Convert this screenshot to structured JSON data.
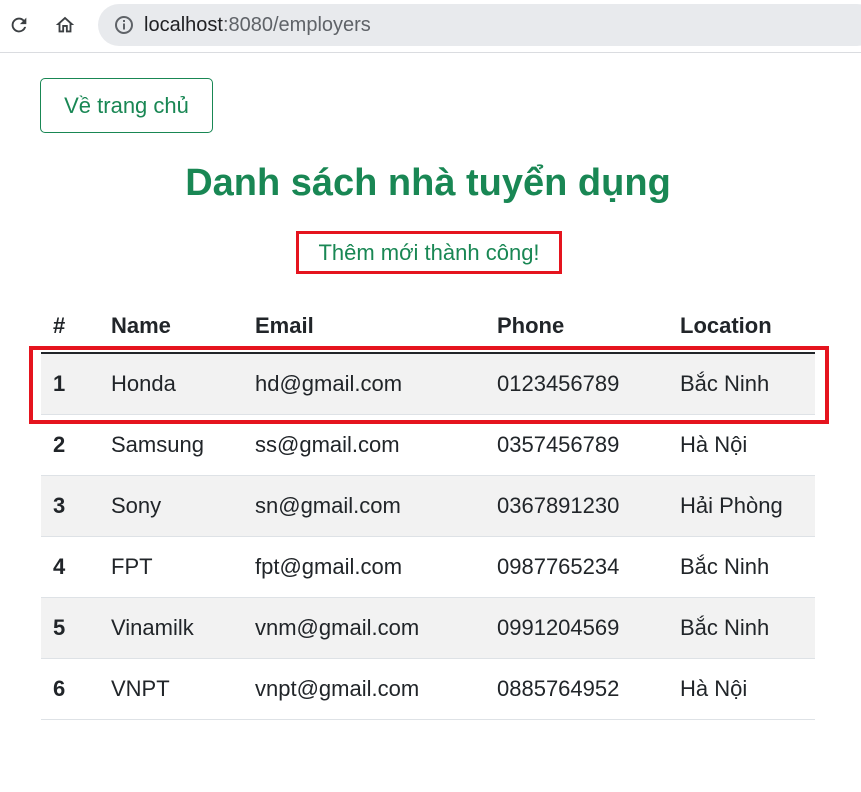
{
  "browser": {
    "url_host": "localhost",
    "url_rest": ":8080/employers"
  },
  "page": {
    "home_button": "Về trang chủ",
    "title": "Danh sách nhà tuyển dụng",
    "success_message": "Thêm mới thành công!"
  },
  "table": {
    "headers": [
      "#",
      "Name",
      "Email",
      "Phone",
      "Location"
    ],
    "rows": [
      {
        "idx": "1",
        "name": "Honda",
        "email": "hd@gmail.com",
        "phone": "0123456789",
        "location": "Bắc Ninh"
      },
      {
        "idx": "2",
        "name": "Samsung",
        "email": "ss@gmail.com",
        "phone": "0357456789",
        "location": "Hà Nội"
      },
      {
        "idx": "3",
        "name": "Sony",
        "email": "sn@gmail.com",
        "phone": "0367891230",
        "location": "Hải Phòng"
      },
      {
        "idx": "4",
        "name": "FPT",
        "email": "fpt@gmail.com",
        "phone": "0987765234",
        "location": "Bắc Ninh"
      },
      {
        "idx": "5",
        "name": "Vinamilk",
        "email": "vnm@gmail.com",
        "phone": "0991204569",
        "location": "Bắc Ninh"
      },
      {
        "idx": "6",
        "name": "VNPT",
        "email": "vnpt@gmail.com",
        "phone": "0885764952",
        "location": "Hà Nội"
      }
    ]
  },
  "colors": {
    "accent": "#198754",
    "highlight": "#e5141e"
  }
}
